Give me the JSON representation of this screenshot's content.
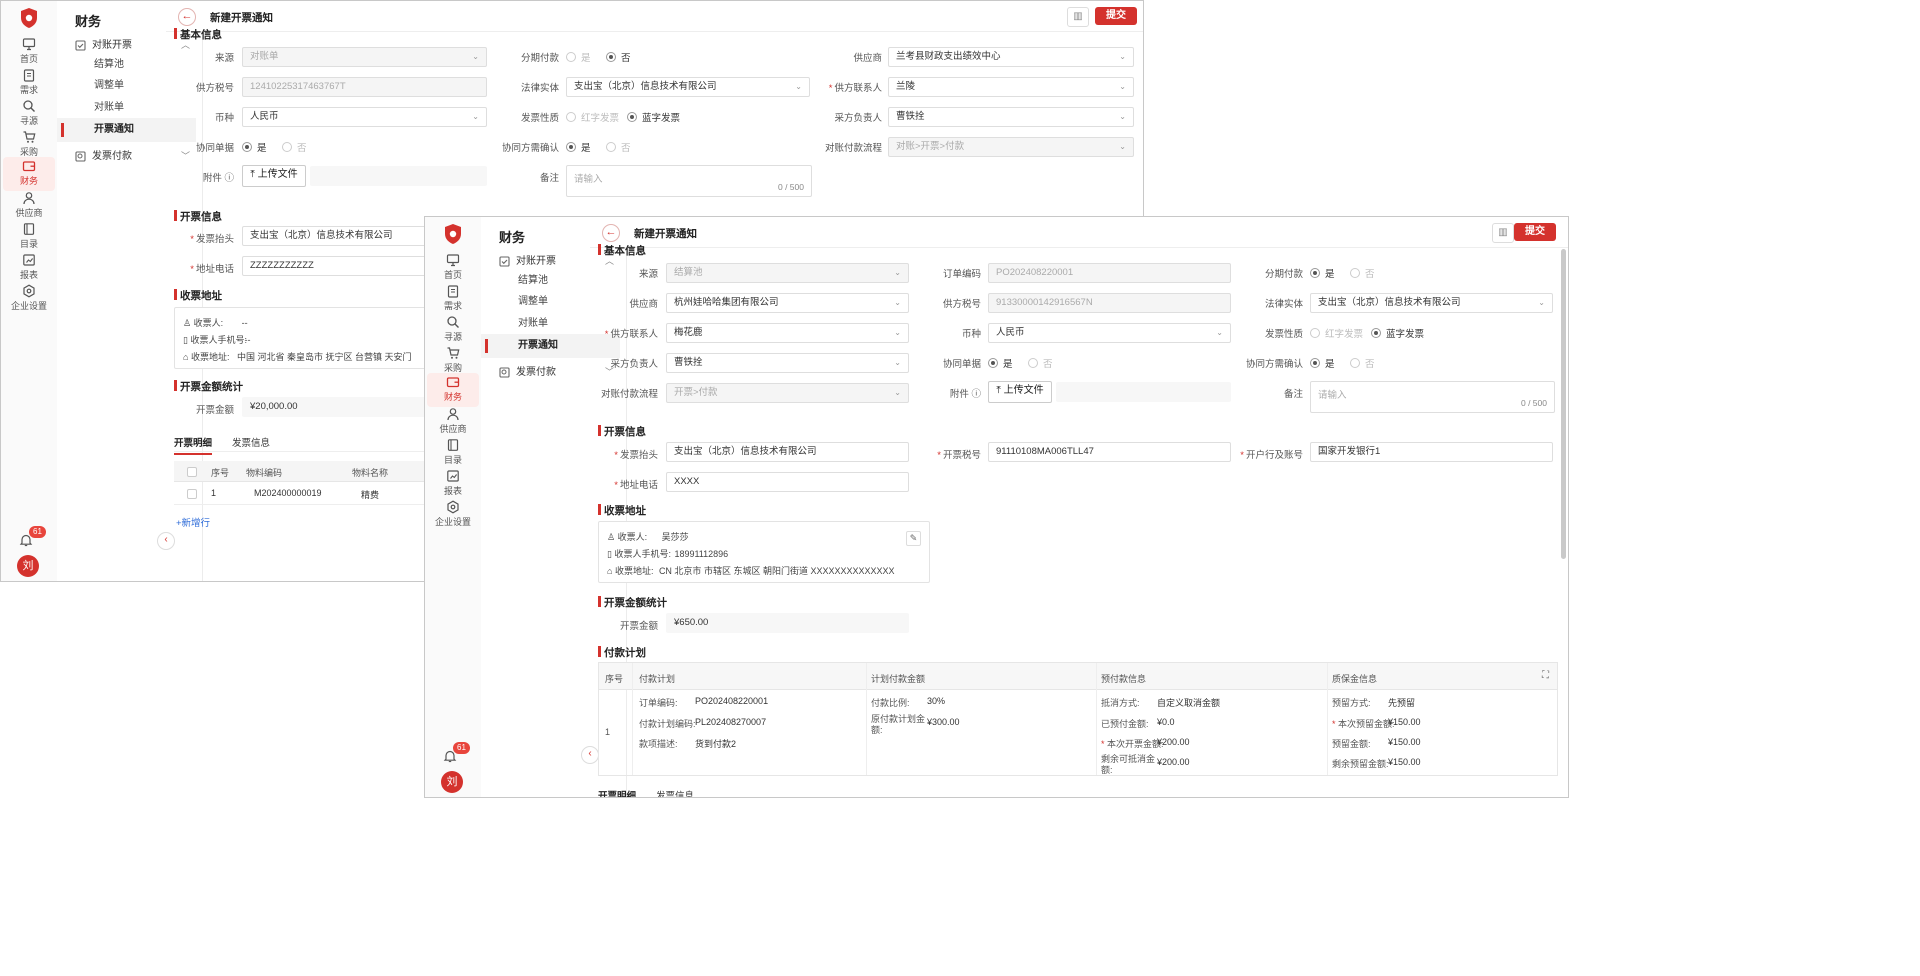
{
  "colors": {
    "brand": "#d4322d",
    "link": "#2d6bd8"
  },
  "icons": [
    "shield-logo-icon",
    "monitor-icon",
    "clipboard-icon",
    "search-icon",
    "cart-icon",
    "finance-icon",
    "person-icon",
    "book-icon",
    "report-icon",
    "settings-icon",
    "bell-icon",
    "chevron-up-icon",
    "chevron-down-icon",
    "back-arrow-icon",
    "layout-icon",
    "upload-icon",
    "info-icon",
    "edit-icon",
    "expand-icon",
    "user-icon",
    "phone-icon",
    "location-icon"
  ],
  "rail": {
    "items": [
      {
        "label": "首页",
        "icon": "monitor-icon"
      },
      {
        "label": "需求",
        "icon": "clipboard-icon"
      },
      {
        "label": "寻源",
        "icon": "search-icon"
      },
      {
        "label": "采购",
        "icon": "cart-icon"
      },
      {
        "label": "财务",
        "icon": "finance-icon"
      },
      {
        "label": "供应商",
        "icon": "person-icon"
      },
      {
        "label": "目录",
        "icon": "book-icon"
      },
      {
        "label": "报表",
        "icon": "report-icon"
      },
      {
        "label": "企业设置",
        "icon": "settings-icon"
      }
    ],
    "notif_count": "61",
    "avatar": "刘"
  },
  "menu": {
    "title": "财务",
    "group1": "对账开票",
    "subs": [
      "结算池",
      "调整单",
      "对账单",
      "开票通知"
    ],
    "group2": "发票付款"
  },
  "header": {
    "title": "新建开票通知",
    "back": "←",
    "submit": "提交",
    "layout_glyph": "▥"
  },
  "common": {
    "arrow": "⌄",
    "collapse": "‹"
  },
  "back_window": {
    "basic_title": "基本信息",
    "source": {
      "label": "来源",
      "value": "对账单"
    },
    "installment": {
      "label": "分期付款",
      "yes": "是",
      "no": "否"
    },
    "supplier": {
      "label": "供应商",
      "value": "兰考县财政支出绩效中心"
    },
    "tax_no": {
      "label": "供方税号",
      "value": "12410225317463767T"
    },
    "legal": {
      "label": "法律实体",
      "value": "支出宝（北京）信息技术有限公司"
    },
    "contact": {
      "label": "供方联系人",
      "value": "兰陵"
    },
    "currency": {
      "label": "币种",
      "value": "人民币"
    },
    "invoice_type": {
      "label": "发票性质",
      "red": "红字发票",
      "blue": "蓝字发票"
    },
    "buyer_owner": {
      "label": "采方负责人",
      "value": "曹铁拴"
    },
    "coop": {
      "label": "协同单据",
      "yes": "是",
      "no": "否"
    },
    "coop_confirm": {
      "label": "协同方需确认",
      "yes": "是",
      "no": "否"
    },
    "flow": {
      "label": "对账付款流程",
      "value": "对账>开票>付款"
    },
    "attach": {
      "label": "附件",
      "button": "上传文件"
    },
    "remark": {
      "label": "备注",
      "placeholder": "请输入",
      "count": "0 / 500"
    },
    "invoice_title_sec": "开票信息",
    "inv_head": {
      "label": "发票抬头",
      "value": "支出宝（北京）信息技术有限公司"
    },
    "addr_phone": {
      "label": "地址电话",
      "value": "ZZZZZZZZZZZ"
    },
    "recv_sec": "收票地址",
    "receiver": {
      "label": "收票人:",
      "value": "--"
    },
    "receiver_phone": {
      "label": "收票人手机号:",
      "value": "--"
    },
    "receiver_addr": {
      "label": "收票地址:",
      "value": "中国 河北省 秦皇岛市 抚宁区 台营镇 天安门"
    },
    "amount_sec": "开票金额统计",
    "amount": {
      "label": "开票金额",
      "value": "¥20,000.00"
    },
    "tabs": [
      "开票明细",
      "发票信息"
    ],
    "table": {
      "headers": [
        "序号",
        "物料编码",
        "物料名称"
      ],
      "row": [
        "1",
        "M202400000019",
        "精费"
      ]
    },
    "add_row": "+新增行"
  },
  "front_window": {
    "basic_title": "基本信息",
    "source": {
      "label": "来源",
      "value": "结算池"
    },
    "order_no": {
      "label": "订单编码",
      "value": "PO202408220001"
    },
    "installment": {
      "label": "分期付款",
      "yes": "是",
      "no": "否"
    },
    "supplier": {
      "label": "供应商",
      "value": "杭州娃哈哈集团有限公司"
    },
    "tax_no": {
      "label": "供方税号",
      "value": "91330000142916567N"
    },
    "legal": {
      "label": "法律实体",
      "value": "支出宝（北京）信息技术有限公司"
    },
    "contact": {
      "label": "供方联系人",
      "value": "梅花鹿"
    },
    "currency": {
      "label": "币种",
      "value": "人民币"
    },
    "invoice_type": {
      "label": "发票性质",
      "red": "红字发票",
      "blue": "蓝字发票"
    },
    "buyer_owner": {
      "label": "采方负责人",
      "value": "曹铁拴"
    },
    "coop": {
      "label": "协同单据",
      "yes": "是",
      "no": "否"
    },
    "coop_confirm": {
      "label": "协同方需确认",
      "yes": "是",
      "no": "否"
    },
    "flow": {
      "label": "对账付款流程",
      "value": "开票>付款"
    },
    "attach": {
      "label": "附件",
      "button": "上传文件"
    },
    "remark": {
      "label": "备注",
      "placeholder": "请输入",
      "count": "0 / 500"
    },
    "invoice_title_sec": "开票信息",
    "inv_head": {
      "label": "发票抬头",
      "value": "支出宝（北京）信息技术有限公司"
    },
    "inv_tax": {
      "label": "开票税号",
      "value": "91110108MA006TLL47"
    },
    "bank": {
      "label": "开户行及账号",
      "value": "国家开发银行1"
    },
    "addr_phone": {
      "label": "地址电话",
      "value": "XXXX"
    },
    "recv_sec": "收票地址",
    "receiver": {
      "label": "收票人:",
      "value": "吴莎莎"
    },
    "receiver_phone": {
      "label": "收票人手机号:",
      "value": "18991112896"
    },
    "receiver_addr": {
      "label": "收票地址:",
      "value": "CN 北京市 市辖区 东城区 朝阳门街道 XXXXXXXXXXXXXX"
    },
    "amount_sec": "开票金额统计",
    "amount": {
      "label": "开票金额",
      "value": "¥650.00"
    },
    "pay_sec": "付款计划",
    "pay_headers": [
      "序号",
      "付款计划",
      "计划付款金额",
      "预付款信息",
      "质保金信息"
    ],
    "pay_row": {
      "seq": "1",
      "order_code": {
        "k": "订单编码:",
        "v": "PO202408220001"
      },
      "plan_code": {
        "k": "付款计划编码:",
        "v": "PL202408270007"
      },
      "desc": {
        "k": "款项描述:",
        "v": "货到付款2"
      },
      "ratio": {
        "k": "付款比例:",
        "v": "30%"
      },
      "orig_amount": {
        "k1": "原付款计划金",
        "k2": "额:",
        "v": "¥300.00"
      },
      "offset_way": {
        "k": "抵消方式:",
        "v": "自定义取消金额"
      },
      "prepaid": {
        "k": "已预付金额:",
        "v": "¥0.0"
      },
      "this_amount": {
        "k": "本次开票金额:",
        "v": "¥200.00"
      },
      "remaining": {
        "k1": "剩余可抵消金",
        "k2": "额:",
        "v": "¥200.00"
      },
      "retention_way": {
        "k": "预留方式:",
        "v": "先预留"
      },
      "this_retention": {
        "k": "本次预留金额:",
        "v": "¥150.00"
      },
      "retention_amt": {
        "k": "预留金额:",
        "v": "¥150.00"
      },
      "remaining_retention": {
        "k": "剩余预留金额:",
        "v": "¥150.00"
      }
    },
    "tabs": [
      "开票明细",
      "发票信息"
    ]
  }
}
